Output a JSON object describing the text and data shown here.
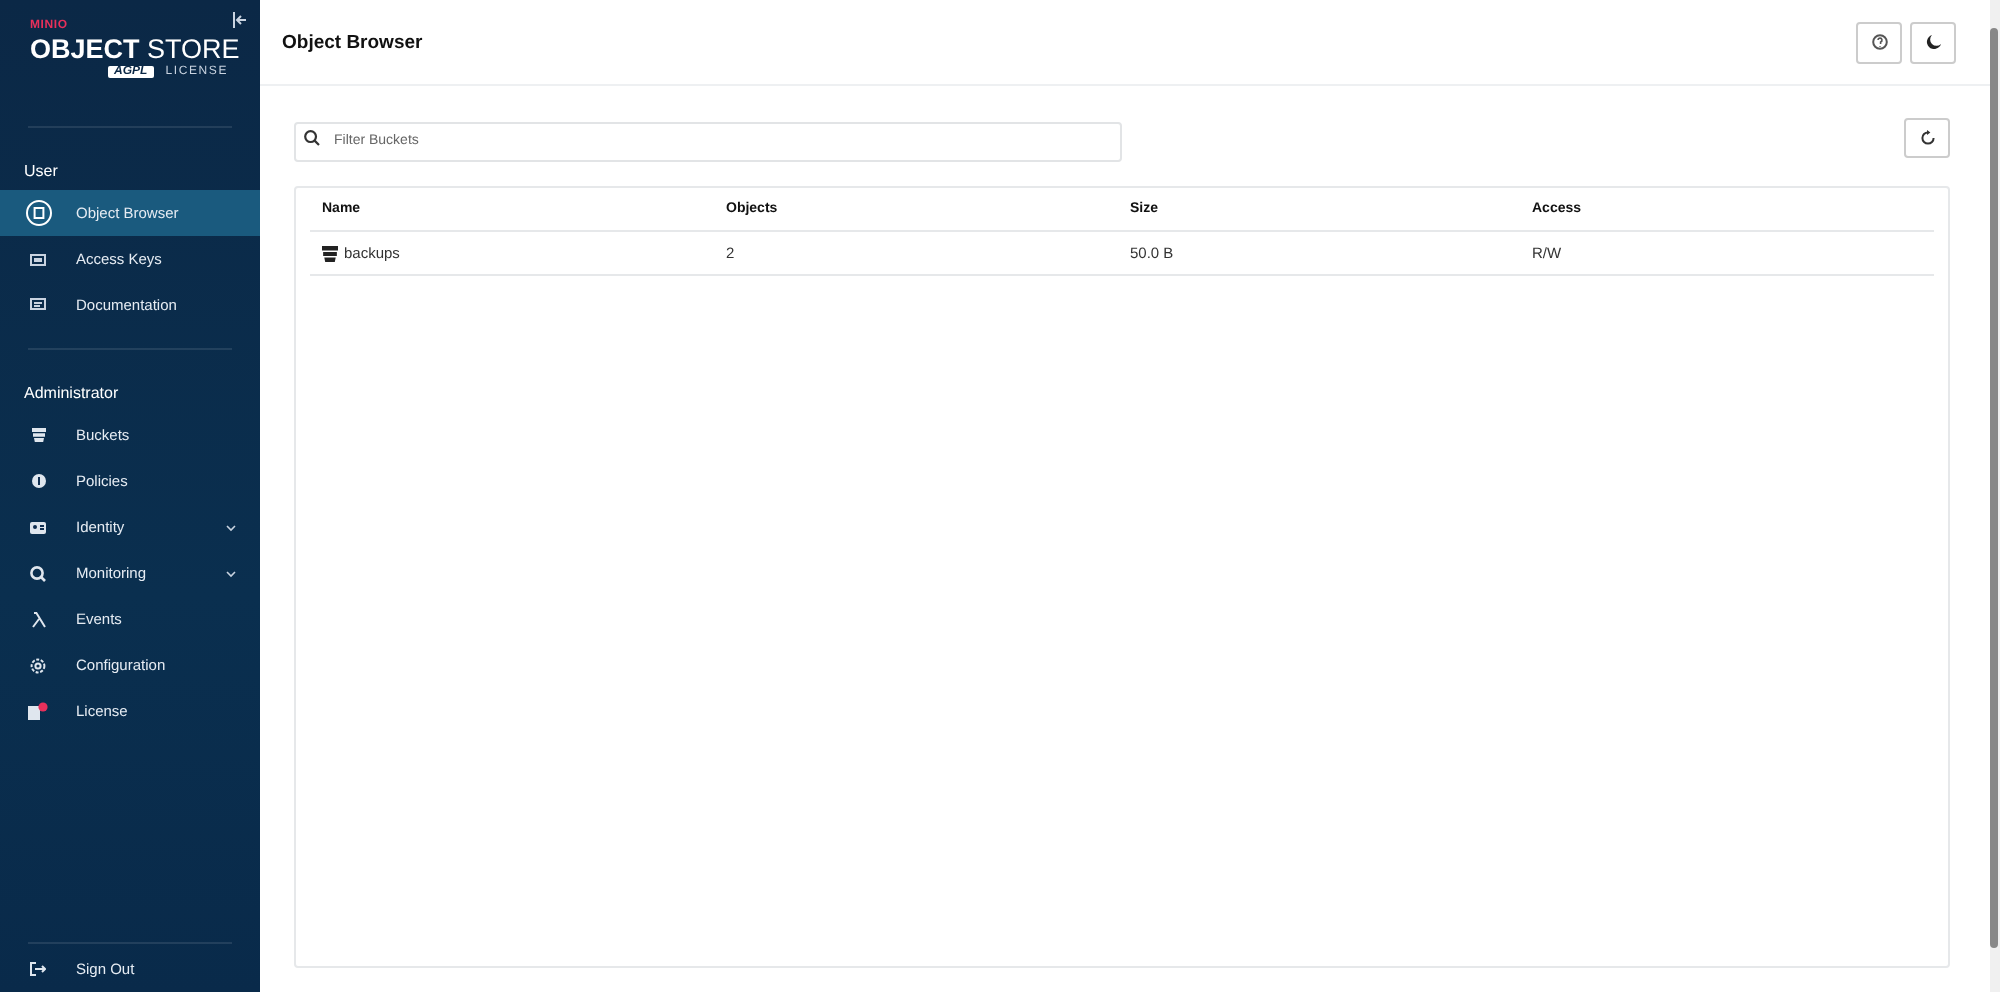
{
  "sidebar": {
    "logo": {
      "brand": "MINIO",
      "product": "**OBJECT** STORE",
      "badge": "AGPL",
      "license": "LICENSE"
    },
    "sections": [
      {
        "title": "User",
        "items": [
          {
            "label": "Object Browser",
            "selected": true
          },
          {
            "label": "Access Keys",
            "selected": false
          },
          {
            "label": "Documentation",
            "selected": false
          }
        ]
      },
      {
        "title": "Administrator",
        "items": [
          {
            "label": "Buckets",
            "selected": false
          },
          {
            "label": "Policies",
            "selected": false
          },
          {
            "label": "Identity",
            "selected": false,
            "expanded": false
          },
          {
            "label": "Monitoring",
            "selected": false,
            "expanded": false
          },
          {
            "label": "Events",
            "selected": false
          },
          {
            "label": "Configuration",
            "selected": false
          },
          {
            "label": "License",
            "selected": false
          }
        ]
      }
    ],
    "sign_out": "Sign Out"
  },
  "header": {
    "title": "Object Browser"
  },
  "search": {
    "placeholder": "Filter Buckets"
  },
  "table": {
    "columns": [
      "Name",
      "Objects",
      "Size",
      "Access"
    ],
    "rows": [
      [
        "backups",
        "2",
        "50.0 B",
        "R/W"
      ]
    ]
  }
}
